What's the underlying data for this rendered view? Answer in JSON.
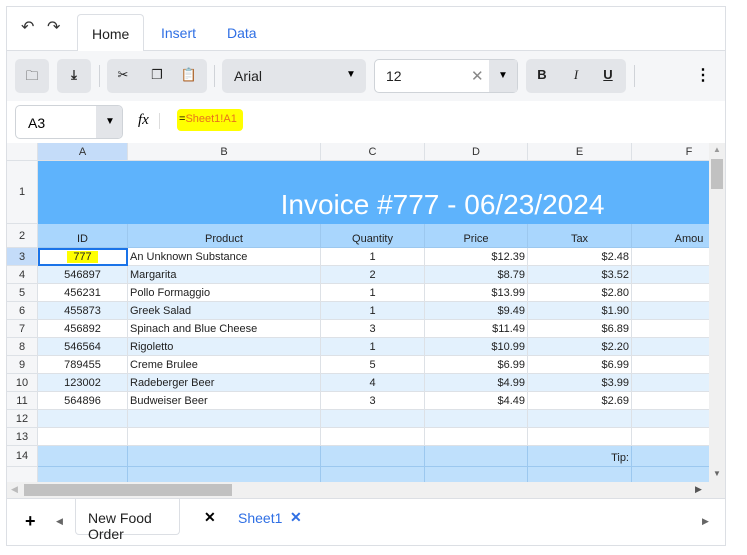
{
  "ribbon": {
    "tabs": [
      {
        "label": "Home",
        "active": true
      },
      {
        "label": "Insert"
      },
      {
        "label": "Data"
      }
    ]
  },
  "toolbar": {
    "font": "Arial",
    "font_size": "12",
    "bold": "B",
    "italic": "I",
    "underline": "U"
  },
  "formula_bar": {
    "cell_ref": "A3",
    "fx": "fx",
    "formula_prefix": "=",
    "formula_ref": "Sheet1!A1"
  },
  "columns": [
    "A",
    "B",
    "C",
    "D",
    "E",
    "F"
  ],
  "rows": [
    "1",
    "2",
    "3",
    "4",
    "5",
    "6",
    "7",
    "8",
    "9",
    "10",
    "11",
    "12",
    "13",
    "14"
  ],
  "sheet": {
    "title": "Invoice #777 - 06/23/2024",
    "headers": [
      "ID",
      "Product",
      "Quantity",
      "Price",
      "Tax",
      "Amou"
    ],
    "items": [
      [
        "777",
        "An Unknown Substance",
        "1",
        "$12.39",
        "$2.48"
      ],
      [
        "546897",
        "Margarita",
        "2",
        "$8.79",
        "$3.52"
      ],
      [
        "456231",
        "Pollo Formaggio",
        "1",
        "$13.99",
        "$2.80"
      ],
      [
        "455873",
        "Greek Salad",
        "1",
        "$9.49",
        "$1.90"
      ],
      [
        "456892",
        "Spinach and Blue Cheese",
        "3",
        "$11.49",
        "$6.89"
      ],
      [
        "546564",
        "Rigoletto",
        "1",
        "$10.99",
        "$2.20"
      ],
      [
        "789455",
        "Creme Brulee",
        "5",
        "$6.99",
        "$6.99"
      ],
      [
        "123002",
        "Radeberger Beer",
        "4",
        "$4.99",
        "$3.99"
      ],
      [
        "564896",
        "Budweiser Beer",
        "3",
        "$4.49",
        "$2.69"
      ]
    ],
    "tip_label": "Tip:",
    "selected_cell": "A3"
  },
  "sheet_tabs": [
    {
      "label": "New Food Order",
      "active": true
    },
    {
      "label": "Sheet1"
    }
  ],
  "colors": {
    "title_bg": "#5eb3fc",
    "header_bg": "#a9d6fd",
    "alt_row": "#e3f1fd",
    "total_bg": "#bfe0fc",
    "selection": "#1a73e8",
    "highlight": "#ffff00",
    "link": "#2f6fe4"
  }
}
